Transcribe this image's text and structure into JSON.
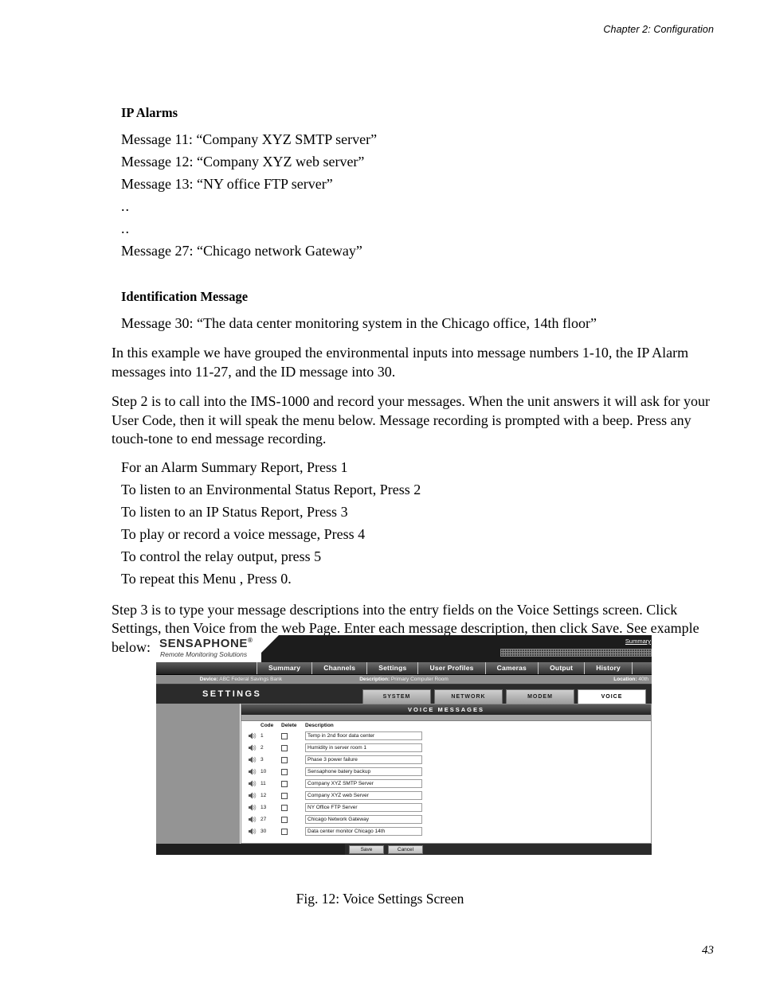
{
  "page": {
    "running_head": "Chapter 2: Configuration",
    "page_number": "43"
  },
  "sections": {
    "ip_alarms": {
      "heading": "IP Alarms",
      "lines": [
        "Message 11: “Company XYZ SMTP server”",
        "Message 12: “Company XYZ web server”",
        "Message 13: “NY office FTP server”",
        "..",
        "..",
        "Message 27: “Chicago network Gateway”"
      ]
    },
    "identification": {
      "heading": "Identification Message",
      "line": "Message 30: “The data center monitoring system in the Chicago office, 14th floor”"
    },
    "para_grouping": "In this example we have grouped the environmental inputs into message numbers 1-10, the IP Alarm messages into 11-27, and the ID message into 30.",
    "para_step2": "Step 2 is to call into the IMS-1000 and record your messages. When the unit answers it will ask for your User Code, then it will speak the menu below. Message recording is prompted with a beep. Press any touch-tone to end message recording.",
    "menu_items": [
      "For an Alarm Summary Report, Press 1",
      "To listen to an Environmental Status Report, Press 2",
      "To listen to an IP Status Report, Press 3",
      "To play or record a voice message, Press 4",
      "To control the relay output, press 5",
      "To repeat this Menu , Press 0."
    ],
    "para_step3": "Step 3 is to type your message descriptions into the entry fields on the Voice Settings screen. Click Settings, then Voice from the web Page. Enter each message description, then click Save. See example below:"
  },
  "figure": {
    "caption": "Fig. 12: Voice Settings Screen",
    "brand": {
      "name": "SENSAPHONE",
      "registered": "®",
      "tagline": "Remote Monitoring Solutions",
      "corner_link": "Summary"
    },
    "main_nav": [
      "Summary",
      "Channels",
      "Settings",
      "User Profiles",
      "Cameras",
      "Output",
      "History"
    ],
    "info_bar": {
      "device_label": "Device:",
      "device_value": "ABC Federal Savings Bank",
      "description_label": "Description:",
      "description_value": "Primary Computer Room",
      "location_label": "Location:",
      "location_value": "40th"
    },
    "settings": {
      "title": "SETTINGS",
      "subtabs": [
        {
          "label": "SYSTEM",
          "active": false
        },
        {
          "label": "NETWORK",
          "active": false
        },
        {
          "label": "MODEM",
          "active": false
        },
        {
          "label": "VOICE",
          "active": true
        }
      ]
    },
    "panel": {
      "title": "VOICE MESSAGES",
      "columns": {
        "code": "Code",
        "delete": "Delete",
        "description": "Description"
      },
      "rows": [
        {
          "code": "1",
          "description": "Temp in 2nd floor data center"
        },
        {
          "code": "2",
          "description": "Humidity in server room 1"
        },
        {
          "code": "3",
          "description": "Phase 3 power failure"
        },
        {
          "code": "10",
          "description": "Sensaphone batery backup"
        },
        {
          "code": "11",
          "description": "Company XYZ SMTP Server"
        },
        {
          "code": "12",
          "description": "Company XYZ web Server"
        },
        {
          "code": "13",
          "description": "NY Office FTP Server"
        },
        {
          "code": "27",
          "description": "Chicago Network Gateway"
        },
        {
          "code": "30",
          "description": "Data center monitor Chicago 14th"
        }
      ]
    },
    "actions": {
      "save": "Save",
      "cancel": "Cancel"
    }
  }
}
